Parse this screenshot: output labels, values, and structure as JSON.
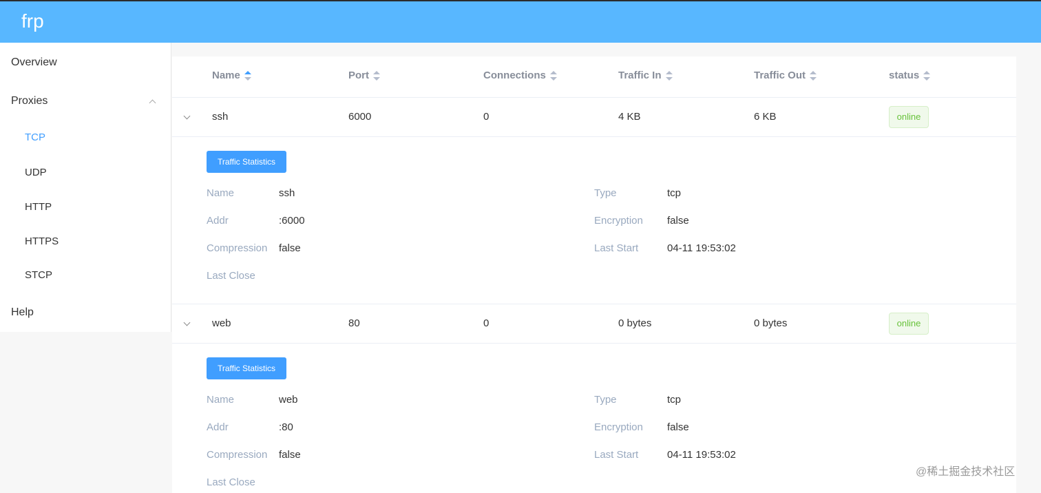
{
  "app": {
    "title": "frp"
  },
  "sidebar": {
    "items": [
      {
        "label": "Overview"
      },
      {
        "label": "Proxies",
        "children": [
          "TCP",
          "UDP",
          "HTTP",
          "HTTPS",
          "STCP"
        ],
        "active_child": "TCP"
      },
      {
        "label": "Help"
      }
    ]
  },
  "table": {
    "columns": [
      "Name",
      "Port",
      "Connections",
      "Traffic In",
      "Traffic Out",
      "status"
    ],
    "sorted_column": "Name",
    "sort_direction": "ascending",
    "rows": [
      {
        "name": "ssh",
        "port": "6000",
        "connections": "0",
        "traffic_in": "4 KB",
        "traffic_out": "6 KB",
        "status": "online",
        "details": {
          "button": "Traffic Statistics",
          "name_label": "Name",
          "name": "ssh",
          "type_label": "Type",
          "type": "tcp",
          "addr_label": "Addr",
          "addr": ":6000",
          "encryption_label": "Encryption",
          "encryption": "false",
          "compression_label": "Compression",
          "compression": "false",
          "last_start_label": "Last Start",
          "last_start": "04-11 19:53:02",
          "last_close_label": "Last Close",
          "last_close": ""
        }
      },
      {
        "name": "web",
        "port": "80",
        "connections": "0",
        "traffic_in": "0 bytes",
        "traffic_out": "0 bytes",
        "status": "online",
        "details": {
          "button": "Traffic Statistics",
          "name_label": "Name",
          "name": "web",
          "type_label": "Type",
          "type": "tcp",
          "addr_label": "Addr",
          "addr": ":80",
          "encryption_label": "Encryption",
          "encryption": "false",
          "compression_label": "Compression",
          "compression": "false",
          "last_start_label": "Last Start",
          "last_start": "04-11 19:53:02",
          "last_close_label": "Last Close",
          "last_close": ""
        }
      }
    ]
  },
  "watermark": "@稀土掘金技术社区",
  "colors": {
    "header": "#58b7ff",
    "accent": "#409eff",
    "online": "#67c23a"
  }
}
